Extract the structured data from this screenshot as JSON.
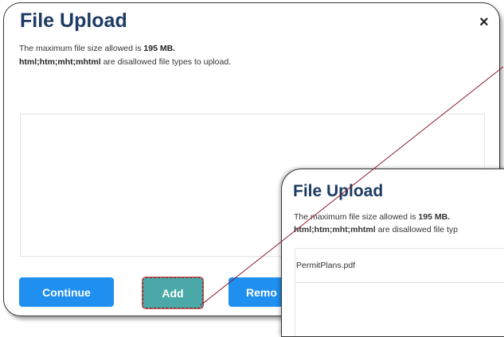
{
  "dialog": {
    "title": "File Upload",
    "close_glyph": "×",
    "max_size_prefix": "The maximum file size allowed is ",
    "max_size_value": "195 MB.",
    "disallowed_types": "html;htm;mht;mhtml",
    "disallowed_suffix": " are disallowed file types to upload."
  },
  "buttons": {
    "continue": "Continue",
    "add": "Add",
    "remove": "Remo"
  },
  "inset": {
    "title": "File Upload",
    "max_size_prefix": "The maximum file size allowed is ",
    "max_size_value": "195 MB.",
    "disallowed_types": "html;htm;mht;mhtml",
    "disallowed_suffix": " are disallowed file typ",
    "file_name": "PermitPlans.pdf"
  },
  "colors": {
    "title": "#1d3b63",
    "primary_button": "#1f8ff0",
    "add_button": "#4aa9a8",
    "pointer_line": "#8a1c2c"
  }
}
